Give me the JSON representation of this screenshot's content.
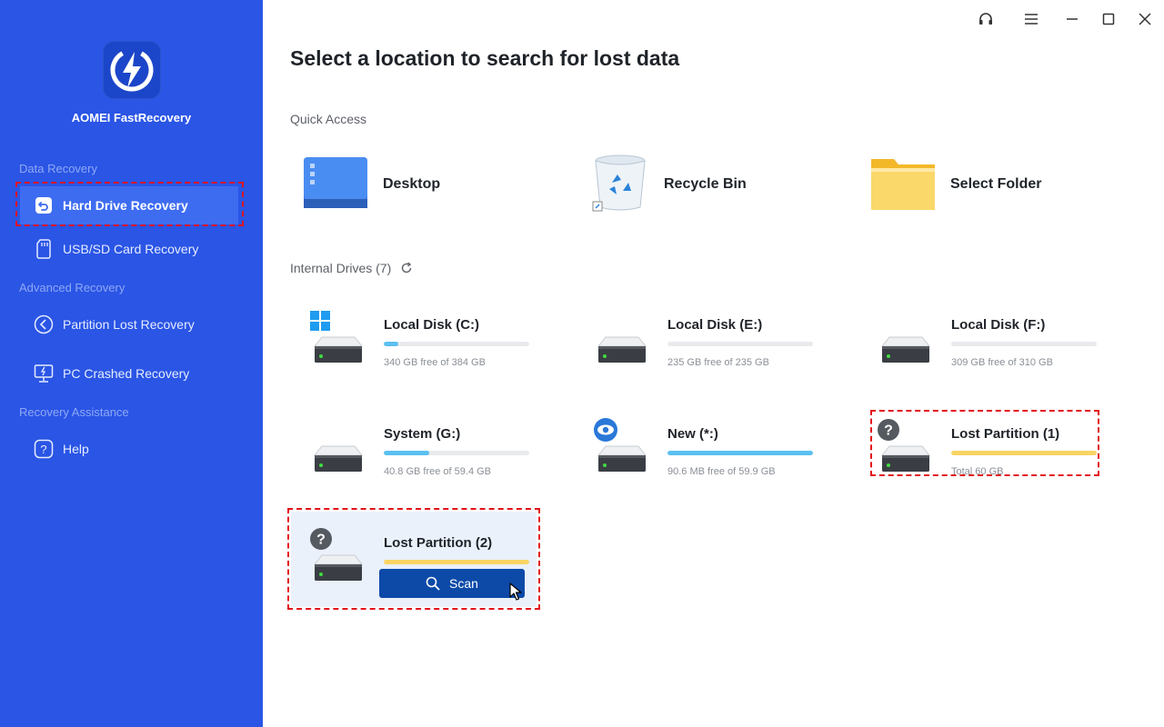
{
  "app": {
    "name": "AOMEI FastRecovery"
  },
  "sidebar": {
    "sections": [
      {
        "label": "Data Recovery"
      },
      {
        "label": "Advanced Recovery"
      },
      {
        "label": "Recovery Assistance"
      }
    ],
    "items": [
      {
        "label": "Hard Drive Recovery",
        "icon": "undo-square-icon",
        "active": true
      },
      {
        "label": "USB/SD Card Recovery",
        "icon": "sd-card-icon"
      },
      {
        "label": "Partition Lost Recovery",
        "icon": "partition-back-icon"
      },
      {
        "label": "PC Crashed Recovery",
        "icon": "monitor-crash-icon"
      },
      {
        "label": "Help",
        "icon": "help-icon"
      }
    ]
  },
  "titlebar": {
    "buttons": [
      "headset-icon",
      "menu-icon",
      "minimize-icon",
      "maximize-icon",
      "close-icon"
    ]
  },
  "main": {
    "title": "Select a location to search for lost data",
    "quick_access": {
      "label": "Quick Access",
      "items": [
        {
          "label": "Desktop",
          "icon": "desktop-icon"
        },
        {
          "label": "Recycle Bin",
          "icon": "recycle-bin-icon"
        },
        {
          "label": "Select Folder",
          "icon": "folder-icon"
        }
      ]
    },
    "internal_drives": {
      "label": "Internal Drives (7)",
      "drives": [
        {
          "name": "Local Disk (C:)",
          "info": "340 GB free of 384 GB",
          "used_fraction": 0.1,
          "bar_color": "#5bc0f0",
          "badge": "windows"
        },
        {
          "name": "Local Disk (E:)",
          "info": "235 GB free of 235 GB",
          "used_fraction": 0.0,
          "bar_color": "#5bc0f0",
          "badge": ""
        },
        {
          "name": "Local Disk (F:)",
          "info": "309 GB free of 310 GB",
          "used_fraction": 0.0,
          "bar_color": "#5bc0f0",
          "badge": ""
        },
        {
          "name": "System (G:)",
          "info": "40.8 GB free of 59.4 GB",
          "used_fraction": 0.31,
          "bar_color": "#5bc0f0",
          "badge": ""
        },
        {
          "name": "New (*:)",
          "info": "90.6 MB free of 59.9 GB",
          "used_fraction": 1.0,
          "bar_color": "#5bc0f0",
          "badge": "eye"
        },
        {
          "name": "Lost Partition (1)",
          "info": "Total 60 GB",
          "used_fraction": 1.0,
          "bar_color": "#f9d464",
          "badge": "question"
        },
        {
          "name": "Lost Partition (2)",
          "info": "",
          "used_fraction": 1.0,
          "bar_color": "#f9d464",
          "badge": "question"
        }
      ]
    },
    "scan_button": {
      "label": "Scan"
    }
  },
  "colors": {
    "sidebar": "#2a55e5",
    "accent": "#0d4aa8",
    "highlight": "#e2121b"
  }
}
